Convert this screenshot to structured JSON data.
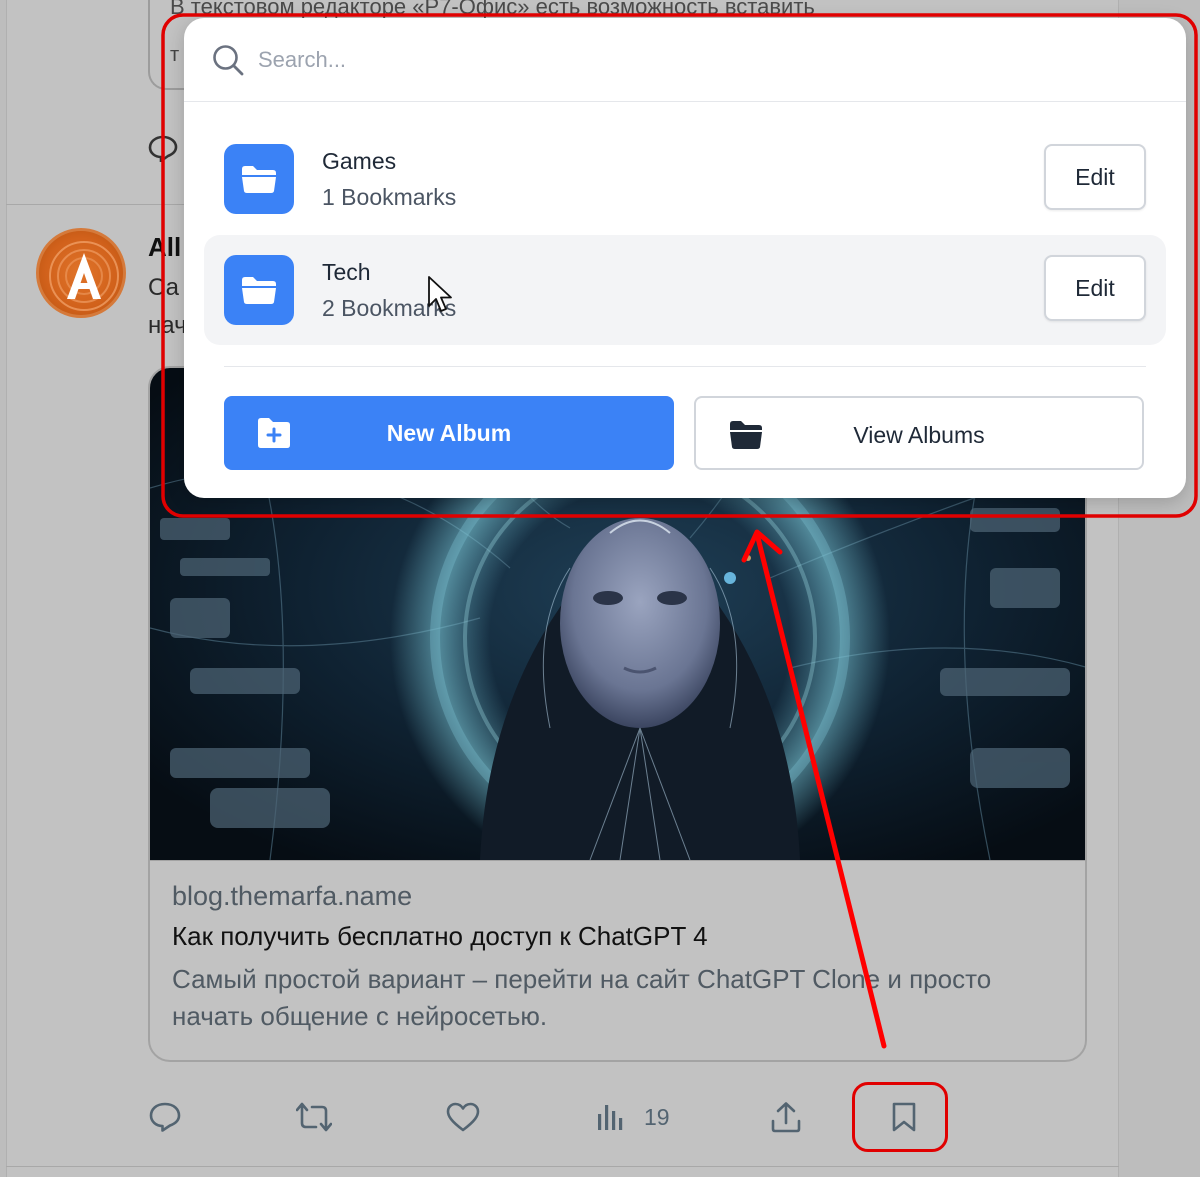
{
  "background_feed": {
    "previous_post_text": "В текстовом редакторе «Р7-Офис» есть возможность вставить",
    "previous_post_fragment": "т",
    "post_author_fragment": "All",
    "post_text_line1_fragment": "Са",
    "post_text_line2_fragment": "нач",
    "link_card": {
      "domain": "blog.themarfa.name",
      "title": "Как получить бесплатно доступ к ChatGPT 4",
      "description": "Самый простой вариант – перейти на сайт ChatGPT Clone и просто начать общение с нейросетью."
    },
    "actions": {
      "views_count": "19"
    }
  },
  "popover": {
    "search": {
      "placeholder": "Search..."
    },
    "albums": [
      {
        "name": "Games",
        "count_label": "1 Bookmarks",
        "edit_label": "Edit"
      },
      {
        "name": "Tech",
        "count_label": "2 Bookmarks",
        "edit_label": "Edit"
      }
    ],
    "new_album_label": "New Album",
    "view_albums_label": "View Albums"
  },
  "colors": {
    "accent": "#3b82f6",
    "annotation": "#e00000",
    "overlay_background": "#bdbdbd"
  }
}
